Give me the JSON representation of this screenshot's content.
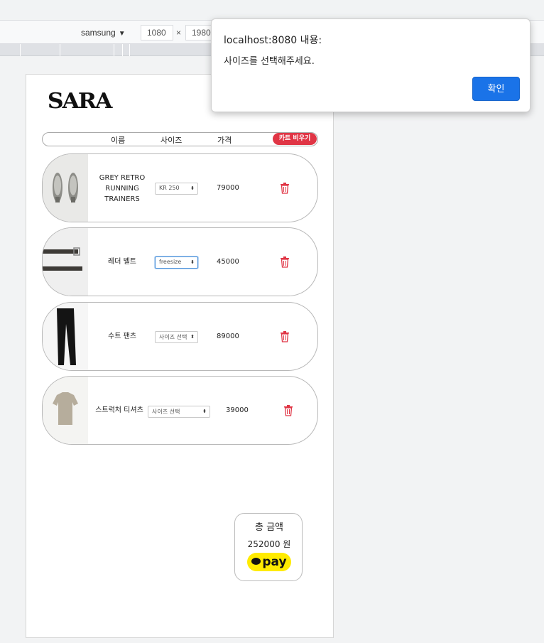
{
  "devtools": {
    "device": "samsung",
    "width": "1080",
    "separator": "×",
    "height": "1980"
  },
  "page": {
    "logo": "SARA",
    "header": {
      "name": "이름",
      "size": "사이즈",
      "price": "가격",
      "clear_cart": "카트 비우기"
    },
    "items": [
      {
        "name": "GREY RETRO RUNNING TRAINERS",
        "size": "KR 250",
        "price": "79000"
      },
      {
        "name": "레더 벨트",
        "size": "freesize",
        "price": "45000"
      },
      {
        "name": "수트 팬츠",
        "size": "사이즈 선택",
        "price": "89000"
      },
      {
        "name": "스트럭처 티셔츠",
        "size": "사이즈 선택",
        "price": "39000"
      }
    ],
    "total": {
      "label": "총 금액",
      "amount": "252000 원",
      "pay_label": "pay"
    }
  },
  "alert": {
    "origin": "localhost:8080 내용:",
    "message": "사이즈를 선택해주세요.",
    "ok_label": "확인"
  },
  "colors": {
    "accent_red": "#e03545",
    "alert_button": "#1a73e8",
    "kakao_yellow": "#ffeb00"
  }
}
